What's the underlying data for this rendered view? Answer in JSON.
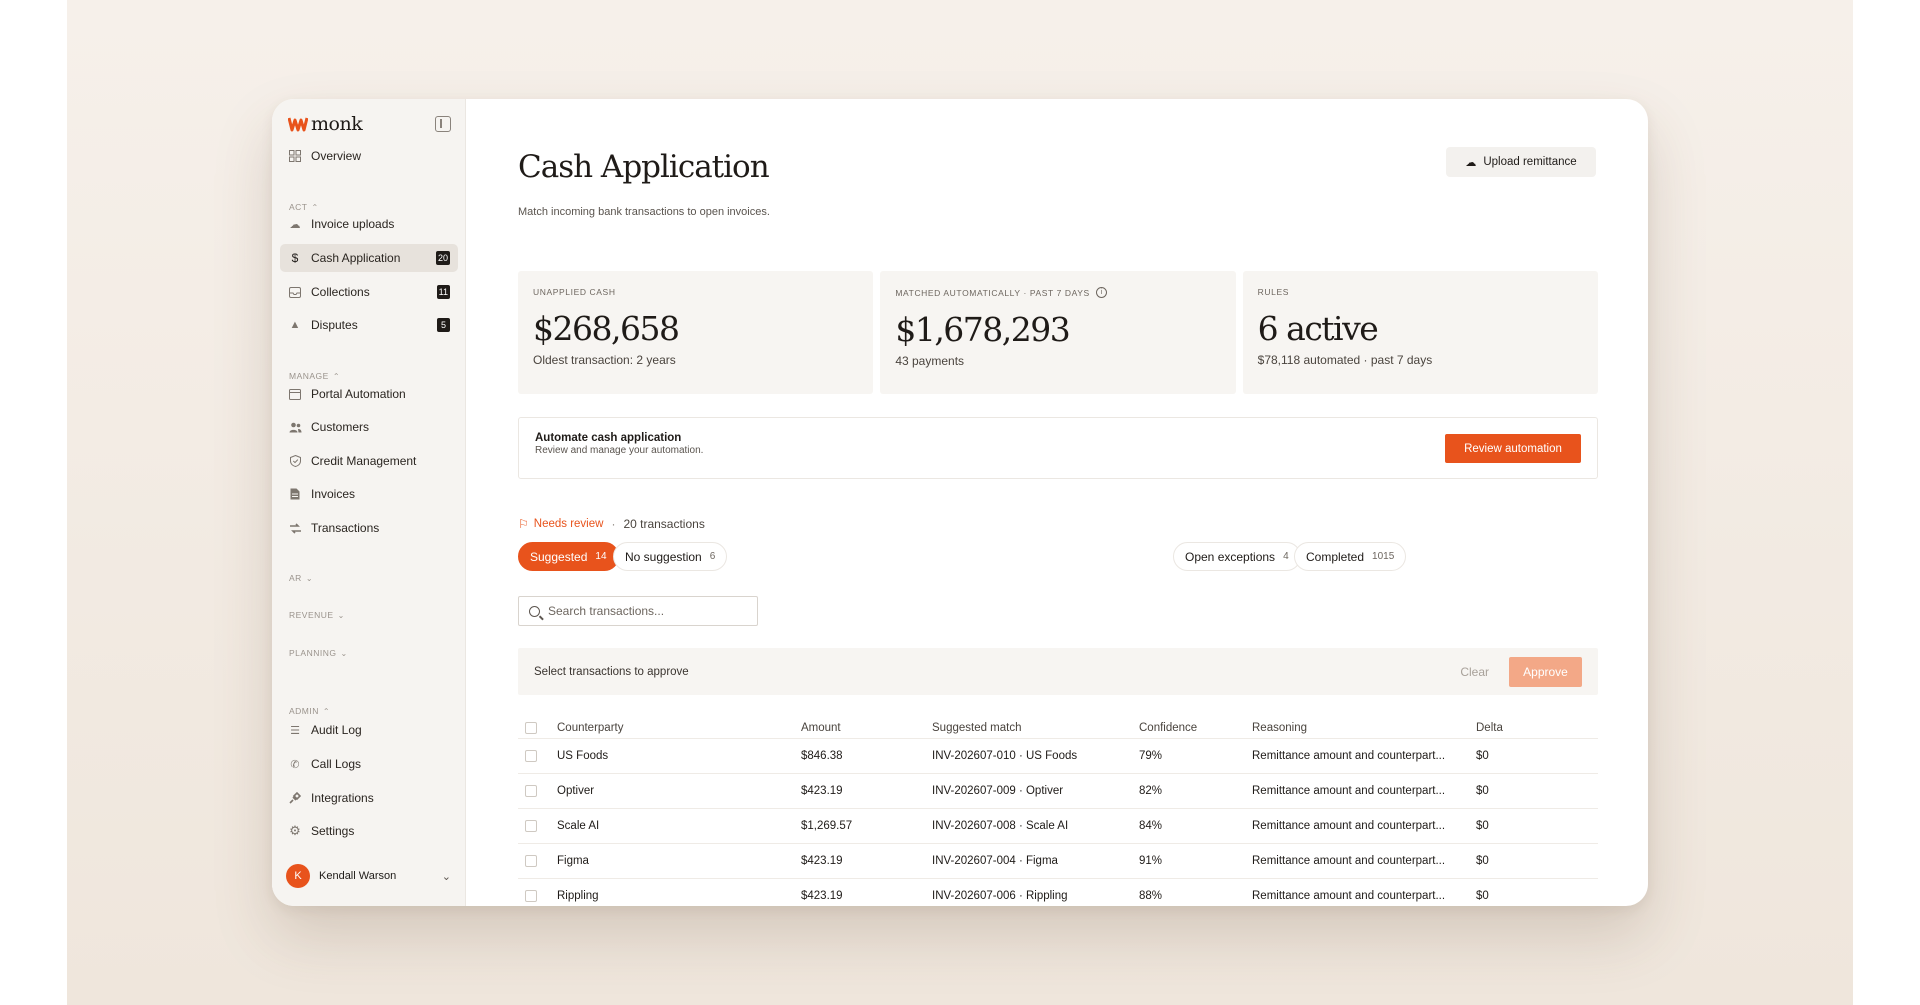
{
  "app": {
    "logo": "monk"
  },
  "sidebar": {
    "overview": "Overview",
    "sections": {
      "act": "ACT",
      "manage": "MANAGE",
      "ar": "AR",
      "revenue": "REVENUE",
      "planning": "PLANNING",
      "admin": "ADMIN"
    },
    "act_items": [
      {
        "label": "Invoice uploads",
        "icon": "upload-icon"
      },
      {
        "label": "Cash Application",
        "icon": "dollar-icon",
        "badge": "20"
      },
      {
        "label": "Collections",
        "icon": "inbox-icon",
        "badge": "11"
      },
      {
        "label": "Disputes",
        "icon": "warning-icon",
        "badge": "5"
      }
    ],
    "manage_items": [
      {
        "label": "Portal Automation",
        "icon": "portal-icon"
      },
      {
        "label": "Customers",
        "icon": "users-icon"
      },
      {
        "label": "Credit Management",
        "icon": "shield-icon"
      },
      {
        "label": "Invoices",
        "icon": "document-icon"
      },
      {
        "label": "Transactions",
        "icon": "transfer-icon"
      }
    ],
    "admin_items": [
      {
        "label": "Audit Log",
        "icon": "list-icon"
      },
      {
        "label": "Call Logs",
        "icon": "phone-icon"
      },
      {
        "label": "Integrations",
        "icon": "plug-icon"
      },
      {
        "label": "Settings",
        "icon": "gear-icon"
      }
    ],
    "user": {
      "initial": "K",
      "name": "Kendall Warson"
    }
  },
  "main": {
    "title": "Cash Application",
    "subtitle": "Match incoming bank transactions to open invoices.",
    "upload_label": "Upload remittance",
    "stats": [
      {
        "label": "UNAPPLIED CASH",
        "value": "$268,658",
        "note": "Oldest transaction: 2 years"
      },
      {
        "label": "MATCHED AUTOMATICALLY · PAST 7 DAYS",
        "value": "$1,678,293",
        "note": "43 payments"
      },
      {
        "label": "RULES",
        "value": "6 active",
        "note": "$78,118 automated · past 7 days"
      }
    ],
    "automate": {
      "title": "Automate cash application",
      "subtitle": "Review and manage your automation.",
      "button": "Review automation"
    },
    "needs_review": {
      "label": "Needs review",
      "count": "20 transactions"
    },
    "tabs": [
      {
        "label": "Suggested",
        "count": "14"
      },
      {
        "label": "No suggestion",
        "count": "6"
      },
      {
        "label": "Open exceptions",
        "count": "4"
      },
      {
        "label": "Completed",
        "count": "1015"
      }
    ],
    "search_placeholder": "Search transactions...",
    "approve_bar": {
      "text": "Select transactions to approve",
      "clear": "Clear",
      "approve": "Approve"
    },
    "table": {
      "headers": [
        "Counterparty",
        "Amount",
        "Suggested match",
        "Confidence",
        "Reasoning",
        "Delta"
      ],
      "rows": [
        [
          "US Foods",
          "$846.38",
          "INV-202607-010 · US Foods",
          "79%",
          "Remittance amount and counterpart...",
          "$0"
        ],
        [
          "Optiver",
          "$423.19",
          "INV-202607-009 · Optiver",
          "82%",
          "Remittance amount and counterpart...",
          "$0"
        ],
        [
          "Scale AI",
          "$1,269.57",
          "INV-202607-008 · Scale AI",
          "84%",
          "Remittance amount and counterpart...",
          "$0"
        ],
        [
          "Figma",
          "$423.19",
          "INV-202607-004 · Figma",
          "91%",
          "Remittance amount and counterpart...",
          "$0"
        ],
        [
          "Rippling",
          "$423.19",
          "INV-202607-006 · Rippling",
          "88%",
          "Remittance amount and counterpart...",
          "$0"
        ]
      ]
    }
  },
  "colors": {
    "accent": "#e8531c",
    "accent_disabled": "#f3a887",
    "sidebar_bg": "#f6f4f1"
  }
}
